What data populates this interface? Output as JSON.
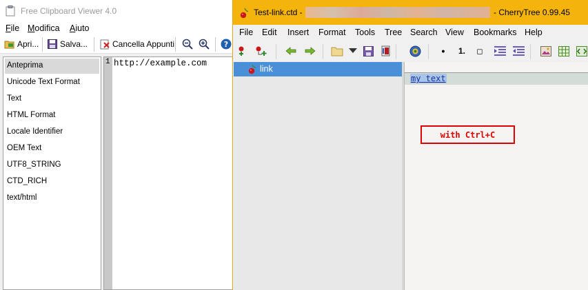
{
  "fcv": {
    "title": "Free Clipboard Viewer 4.0",
    "menu": [
      {
        "label": "File",
        "underline": "F",
        "rest": "ile"
      },
      {
        "label": "Modifica",
        "underline": "M",
        "rest": "odifica"
      },
      {
        "label": "Aiuto",
        "underline": "A",
        "rest": "iuto"
      }
    ],
    "toolbar": {
      "open_label": "Apri...",
      "save_label": "Salva...",
      "clear_label": "Cancella Appunti"
    },
    "formats": [
      "Anteprima",
      "Unicode Text Format",
      "Text",
      "HTML Format",
      "Locale Identifier",
      "OEM Text",
      "UTF8_STRING",
      "CTD_RICH",
      "text/html"
    ],
    "editor": {
      "line_number": "1",
      "content": "http://example.com"
    }
  },
  "cherrytree": {
    "title_file": "Test-link.ctd -",
    "title_app": "- CherryTree 0.99.45",
    "menu": [
      "File",
      "Edit",
      "Insert",
      "Format",
      "Tools",
      "Tree",
      "Search",
      "View",
      "Bookmarks",
      "Help"
    ],
    "toolbar_text": {
      "bullet_list": "•",
      "numbered_list": "1.",
      "todo_list": "◻"
    },
    "tree": {
      "selected_node": "link"
    },
    "text": {
      "link_text": "my text",
      "annotation": "with Ctrl+C"
    },
    "colors": {
      "title_bar": "#f4b40c",
      "selection": "#4a90d9",
      "annotation": "#e00000",
      "link": "#1a33a0"
    }
  }
}
